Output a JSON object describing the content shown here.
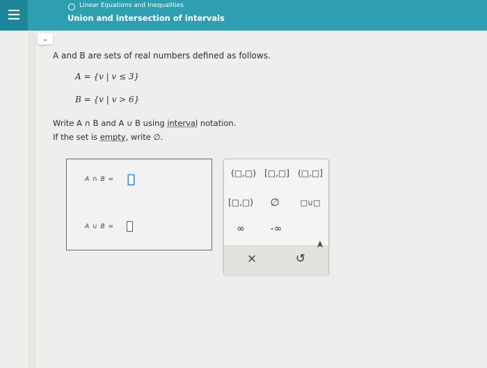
{
  "header": {
    "topic": "Linear Equations and Inequalities",
    "title": "Union and intersection of intervals"
  },
  "problem": {
    "intro": "A and B are sets of real numbers defined as follows.",
    "set_a": "A = {v | v ≤ 3}",
    "set_b": "B = {v | v > 6}",
    "instruction": "Write A ∩ B and A ∪ B using interval notation.",
    "interval_link": "interval",
    "empty_prefix": "If the set is ",
    "empty_link": "empty",
    "empty_suffix": ", write ∅."
  },
  "answers": {
    "intersection_label": "A ∩ B =",
    "union_label": "A ∪ B ="
  },
  "keypad": {
    "open_open": "(□,□)",
    "closed_closed": "[□,□]",
    "open_closed": "(□,□]",
    "closed_open": "[□,□)",
    "empty_set": "∅",
    "union": "□∪□",
    "infinity": "∞",
    "neg_infinity": "-∞",
    "clear": "×",
    "undo": "↺"
  }
}
